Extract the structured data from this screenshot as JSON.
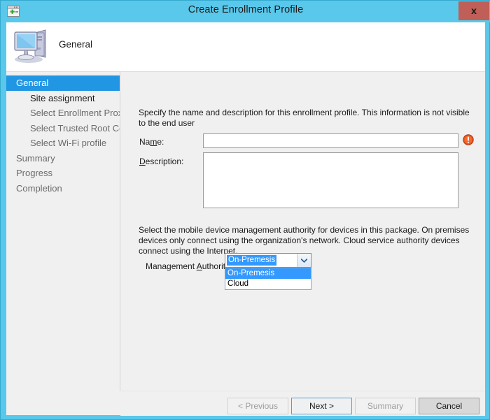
{
  "window": {
    "title": "Create Enrollment Profile",
    "icon": "new-window-icon",
    "close_label": "x",
    "title_bar_color": "#59c8ea"
  },
  "banner": {
    "icon": "computer-icon",
    "title": "General"
  },
  "sidebar": {
    "items": [
      {
        "label": "General",
        "level": 0,
        "state": "selected"
      },
      {
        "label": "Site assignment",
        "level": 1,
        "state": "current"
      },
      {
        "label": "Select Enrollment Proxy P",
        "level": 1,
        "state": "normal"
      },
      {
        "label": "Select Trusted Root Certif",
        "level": 1,
        "state": "normal"
      },
      {
        "label": "Select Wi-Fi profile",
        "level": 1,
        "state": "normal"
      },
      {
        "label": "Summary",
        "level": 0,
        "state": "normal"
      },
      {
        "label": "Progress",
        "level": 0,
        "state": "normal"
      },
      {
        "label": "Completion",
        "level": 0,
        "state": "normal"
      }
    ],
    "scrollbar": {
      "left_arrow": "‹",
      "right_arrow": "›",
      "grip": "IIII"
    }
  },
  "main": {
    "intro_text": "Specify the name and description for this enrollment profile. This information is not visible to the end user",
    "name_label_pre": "Na",
    "name_label_acc": "m",
    "name_label_post": "e:",
    "name_value": "",
    "name_placeholder": "",
    "description_label_acc": "D",
    "description_label_post": "escription:",
    "description_value": "",
    "description_placeholder": "",
    "error_icon": "error-exclamation-icon",
    "mgmt_text": "Select the mobile device management authority for devices in this package. On premises devices only connect using the organization's network. Cloud service authority devices connect using the Internet.",
    "auth_label_pre": "Management ",
    "auth_label_acc": "A",
    "auth_label_post": "uthority",
    "combo": {
      "selected": "On-Premesis",
      "arrow": "❯",
      "options": [
        {
          "label": "On-Premesis",
          "highlighted": true
        },
        {
          "label": "Cloud",
          "highlighted": false
        }
      ]
    }
  },
  "footer": {
    "buttons": [
      {
        "label": "< Previous",
        "state": "disabled"
      },
      {
        "label": "Next >",
        "state": "default"
      },
      {
        "label": "Summary",
        "state": "disabled"
      },
      {
        "label": "Cancel",
        "state": "normal"
      }
    ]
  }
}
